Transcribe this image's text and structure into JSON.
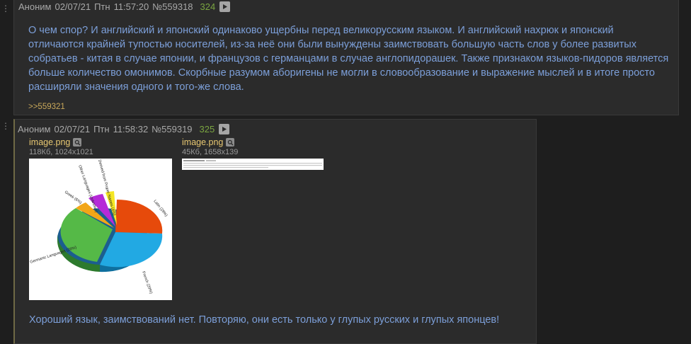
{
  "posts": [
    {
      "author": "Аноним",
      "date": "02/07/21",
      "weekday": "Птн",
      "time": "11:57:20",
      "number": "№559318",
      "reply_count": "324",
      "message": "О чем спор? И английский и японский одинаково ущербны перед великорусским языком. И английский нахрюк и японский отличаются крайней тупостью носителей, из-за неё они были вынуждены заимствовать большую часть слов у более развитых собратьев - китая в случае японии, и французов с германцами в случае англопидорашек. Также признаком языков-пидоров является больше количество омонимов. Скорбные разумом аборигены не могли в словообразование и выражение мыслей и в итоге просто расширяли значения одного и того-же слова.",
      "reply_link": ">>559321"
    },
    {
      "author": "Аноним",
      "date": "02/07/21",
      "weekday": "Птн",
      "time": "11:58:32",
      "number": "№559319",
      "reply_count": "325",
      "files": [
        {
          "name": "image.png",
          "meta": "118Кб, 1024x1021"
        },
        {
          "name": "image.png",
          "meta": "45Кб, 1658x139"
        }
      ],
      "message": "Хороший язык, заимствований нет. Повторяю, они есть только у глупых русских и глупых японцев!"
    }
  ],
  "pie_labels": {
    "latin": "Latin (29%)",
    "french": "French (29%)",
    "germanic": "Germanic Languages (26%)",
    "greek": "Greek (6%)",
    "other": "Other Languages (Unknown)",
    "proper": "Derived from Proper Names (4%)"
  },
  "icons": {
    "play": "play-icon",
    "zoom": "search-icon"
  },
  "colors": {
    "background": "#1e1e1e",
    "post_bg": "#2b2b2b",
    "message": "#7c9fd9",
    "reply_count": "#7aa540",
    "file_name": "#e8c872",
    "reply_link": "#c9a85a"
  }
}
